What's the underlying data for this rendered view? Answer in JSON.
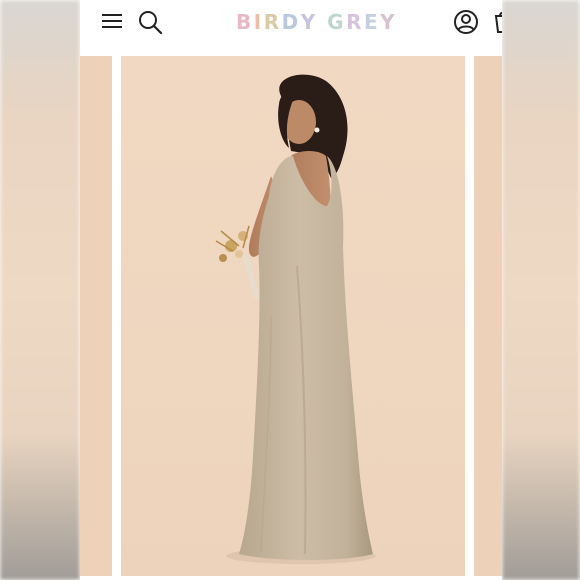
{
  "header": {
    "logo_text": "BIRDY GREY",
    "logo_colors": [
      "#e7b9c6",
      "#e9bfa8",
      "#dcc9a6",
      "#b9c9dd",
      "#c6c4e0",
      "#bfd6cf",
      "#d6c3dc",
      "#c5cfe2",
      "#d9c2cf",
      "#bcd3e0"
    ],
    "icons": [
      "menu-icon",
      "search-icon",
      "account-icon",
      "shopping-bag-icon"
    ]
  },
  "product_image": {
    "background_color": "#efd6bf",
    "dress_color": "#c9b9a2",
    "image_subject": "model-photo"
  }
}
